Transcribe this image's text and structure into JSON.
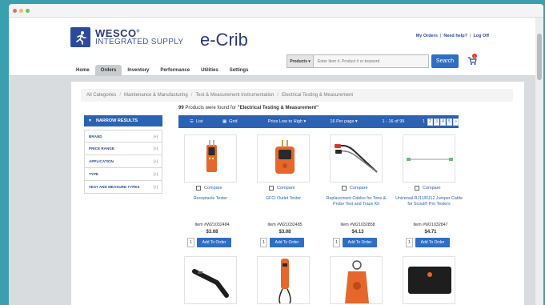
{
  "window": {
    "dots": [
      "red",
      "yellow",
      "green"
    ]
  },
  "site": {
    "logo": {
      "name": "WESCO",
      "registered": "®",
      "sub": "INTEGRATED SUPPLY"
    },
    "brand": "e-Crib",
    "toplinks": [
      "My Orders",
      "Need help?",
      "Log Off"
    ],
    "nav": [
      "Home",
      "Orders",
      "Inventory",
      "Performance",
      "Utilities",
      "Settings"
    ],
    "nav_active": "Orders",
    "search": {
      "category": "Products ▾",
      "placeholder": "Enter Item #, Product # or keyword",
      "button": "Search"
    },
    "cart_count": "1"
  },
  "breadcrumb": [
    "All Categories",
    "Maintenance & Manufacturing",
    "Test & Measurement Instrumentation",
    "Electrical Testing & Measurement"
  ],
  "results": {
    "count": "99",
    "text": "Products were found for",
    "query": "\"Electrical Testing & Measurement\""
  },
  "sidebar": {
    "title": "NARROW RESULTS",
    "filters": [
      "BRAND",
      "PRICE RANGE",
      "APPLICATION",
      "TYPE",
      "TEST AND MEASURE TYPES"
    ],
    "toggle": "[+]"
  },
  "toolbar": {
    "list": "List",
    "grid": "Grid",
    "sort": "Price Low to High ▾",
    "perpage": "16 Per page ▾",
    "range": "1 - 16 of 99",
    "pages": [
      "1",
      "2",
      "3",
      "4",
      "5",
      "»"
    ]
  },
  "products": [
    {
      "name": "Receptacle Tester",
      "item": "Item #W21032484",
      "price": "$3.68",
      "qty": "1",
      "image": "receptacle-tester"
    },
    {
      "name": "GFCI Outlet Tester",
      "item": "Item #W21032485",
      "price": "$3.08",
      "qty": "1",
      "image": "gfci-tester"
    },
    {
      "name": "Replacement Cables for Tone & Probe Test and Trace Kit",
      "item": "Item #W21032858",
      "price": "$4.13",
      "qty": "1",
      "image": "probe-cables"
    },
    {
      "name": "Universal RJ11/RJ12 Jumper Cable for Scout® Pro Testers",
      "item": "Item #W21032847",
      "price": "$4.71",
      "qty": "1",
      "image": "jumper-cable"
    }
  ],
  "labels": {
    "compare": "Compare",
    "add_to_order": "Add To Order"
  },
  "colors": {
    "accent": "#2b62b4",
    "button": "#2e6ec4",
    "product_orange": "#e6672a",
    "background": "#3a9fae"
  }
}
